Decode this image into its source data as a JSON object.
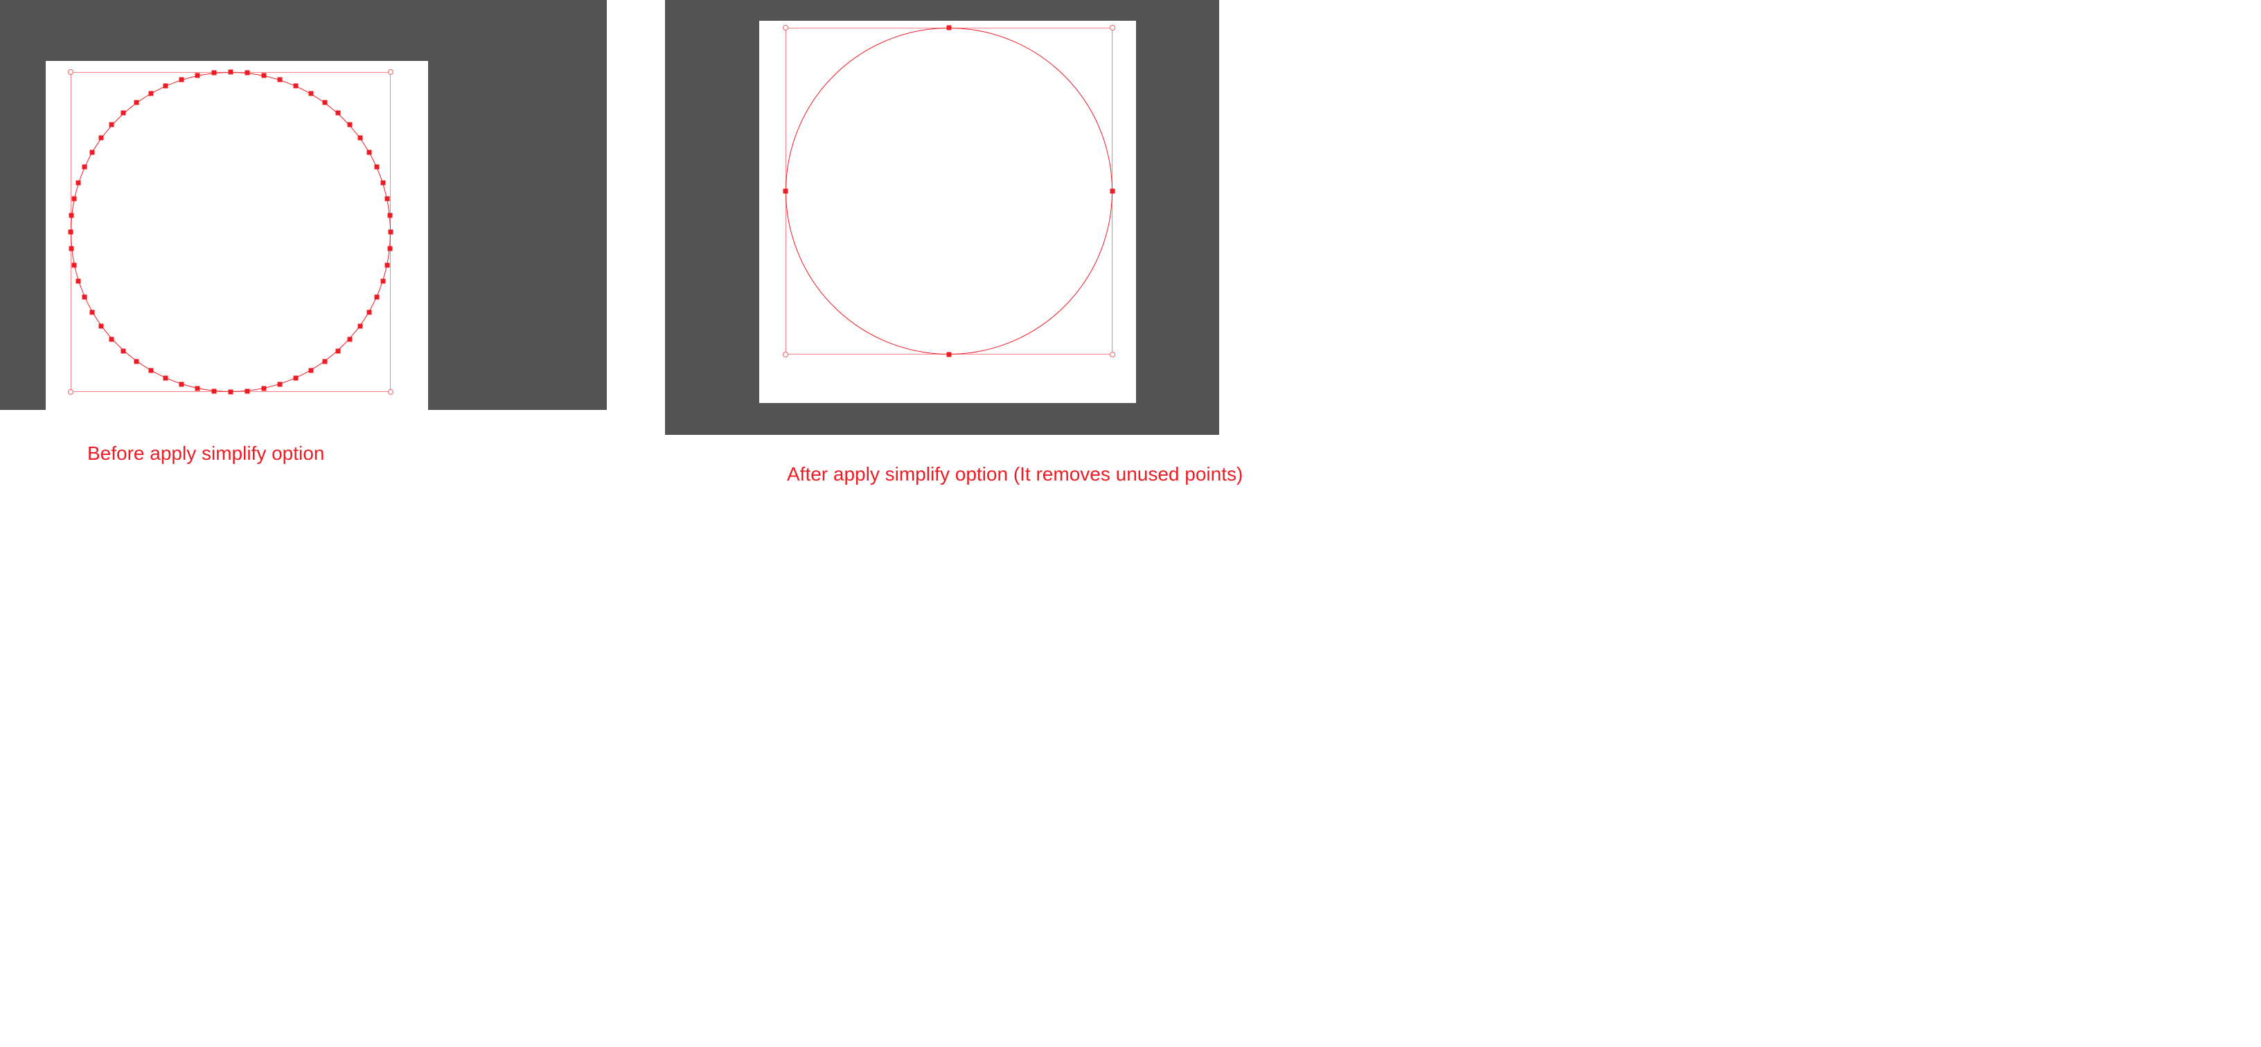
{
  "colors": {
    "editor_bg": "#535353",
    "artboard": "#ffffff",
    "path": "#ed1c24",
    "caption": "#ed1c24"
  },
  "before": {
    "caption": "Before apply simplify option",
    "anchor_point_count": 60,
    "bbox_handles": [
      "top-left",
      "top-right",
      "bottom-left",
      "bottom-right"
    ]
  },
  "after": {
    "caption": "After apply simplify option (It removes unused points)",
    "anchor_point_count": 4,
    "anchor_positions_deg": [
      0,
      90,
      180,
      270
    ],
    "bbox_handles": [
      "top-left",
      "top-right",
      "bottom-left",
      "bottom-right"
    ]
  }
}
